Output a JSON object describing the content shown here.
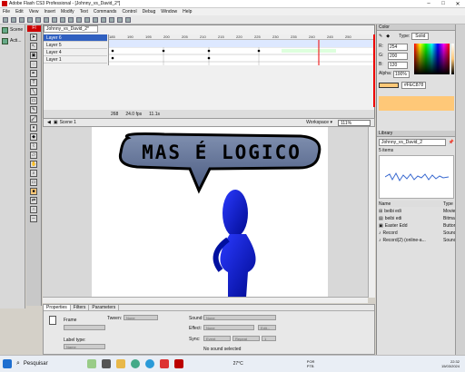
{
  "window": {
    "title": "Adobe Flash CS3 Professional - [Johnny_vs_David_2*]",
    "minimize": "–",
    "maximize": "□",
    "close": "✕"
  },
  "menu": [
    "File",
    "Edit",
    "View",
    "Insert",
    "Modify",
    "Text",
    "Commands",
    "Control",
    "Debug",
    "Window",
    "Help"
  ],
  "side": {
    "scene": "Scene",
    "actions": "Acti..."
  },
  "tools": {
    "brand": "Fl",
    "text_tool": "T"
  },
  "timeline": {
    "doc_tab": "Johnny_vs_David_2*",
    "layers": [
      "Layer 6",
      "Layer 5",
      "Layer 4",
      "Layer 1"
    ],
    "ruler": [
      "185",
      "190",
      "195",
      "200",
      "205",
      "210",
      "215",
      "220",
      "225",
      "230",
      "235",
      "240",
      "245",
      "250",
      "255",
      "260",
      "265"
    ],
    "frame": "268",
    "fps": "24.0 fps",
    "time": "11.1s"
  },
  "stage": {
    "scene": "Scene 1",
    "workspace": "Workspace ▾",
    "zoom": "111%",
    "speech_text": "MAS É LOGICO"
  },
  "properties": {
    "tabs": [
      "Properties",
      "Filters",
      "Parameters"
    ],
    "frame_label": "Frame",
    "tween_label": "Tween:",
    "tween_value": "None",
    "label_type": "Label type:",
    "name_value": "Name",
    "sound_label": "Sound:",
    "sound_value": "None",
    "effect_label": "Effect:",
    "effect_value": "None",
    "edit_btn": "Edit...",
    "sync_label": "Sync:",
    "sync_value": "Event",
    "repeat_value": "Repeat",
    "repeat_count": "1",
    "no_sound": "No sound selected"
  },
  "color": {
    "title": "Color",
    "type_label": "Type:",
    "type_value": "Solid",
    "r_label": "R:",
    "r": "254",
    "g_label": "G:",
    "g": "200",
    "b_label": "B:",
    "b": "120",
    "alpha_label": "Alpha:",
    "alpha": "100%",
    "hex": "#FEC878",
    "swatch": "#FEC878"
  },
  "library": {
    "title": "Library",
    "doc": "Johnny_vs_David_2",
    "count": "5 items",
    "col_name": "Name",
    "col_type": "Type",
    "items": [
      {
        "name": "beibi edi",
        "type": "Movie"
      },
      {
        "name": "beibi edi",
        "type": "Bitmap"
      },
      {
        "name": "Easter Edd",
        "type": "Button"
      },
      {
        "name": "Record",
        "type": "Sound"
      },
      {
        "name": "Record(2) (online-a...",
        "type": "Sound"
      }
    ]
  },
  "taskbar": {
    "search": "Pesquisar",
    "temp": "27°C",
    "lang": "POR PTB",
    "time": "22:32",
    "date": "15/03/2024"
  }
}
